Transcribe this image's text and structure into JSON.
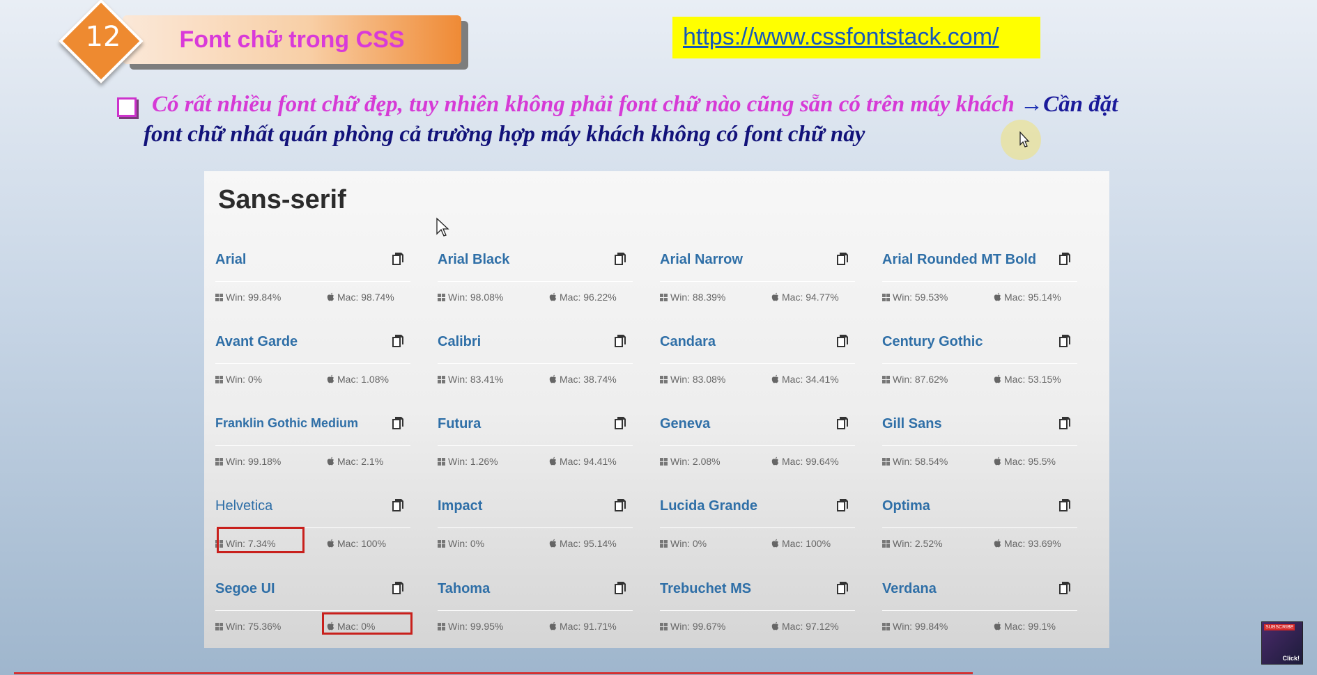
{
  "header": {
    "badge_number": "12",
    "title": "Font chữ trong CSS",
    "url": "https://www.cssfontstack.com/"
  },
  "bullet": {
    "line1_text": "Có rất nhiều font chữ đẹp, tuy nhiên không phải font chữ nào cũng sẵn có trên máy khách",
    "line1_arrow": "→",
    "line1_tail": "Cần đặt",
    "line2_text": "font chữ nhất quán phòng cả trường hợp máy khách không có font chữ này"
  },
  "panel": {
    "title": "Sans-serif",
    "fonts": [
      {
        "name": "Arial",
        "win": "Win: 99.84%",
        "mac": "Mac: 98.74%"
      },
      {
        "name": "Arial Black",
        "win": "Win: 98.08%",
        "mac": "Mac: 96.22%"
      },
      {
        "name": "Arial Narrow",
        "win": "Win: 88.39%",
        "mac": "Mac: 94.77%"
      },
      {
        "name": "Arial Rounded MT Bold",
        "win": "Win: 59.53%",
        "mac": "Mac: 95.14%"
      },
      {
        "name": "Avant Garde",
        "win": "Win: 0%",
        "mac": "Mac: 1.08%"
      },
      {
        "name": "Calibri",
        "win": "Win: 83.41%",
        "mac": "Mac: 38.74%"
      },
      {
        "name": "Candara",
        "win": "Win: 83.08%",
        "mac": "Mac: 34.41%"
      },
      {
        "name": "Century Gothic",
        "win": "Win: 87.62%",
        "mac": "Mac: 53.15%"
      },
      {
        "name": "Franklin Gothic Medium",
        "win": "Win: 99.18%",
        "mac": "Mac: 2.1%"
      },
      {
        "name": "Futura",
        "win": "Win: 1.26%",
        "mac": "Mac: 94.41%"
      },
      {
        "name": "Geneva",
        "win": "Win: 2.08%",
        "mac": "Mac: 99.64%"
      },
      {
        "name": "Gill Sans",
        "win": "Win: 58.54%",
        "mac": "Mac: 95.5%"
      },
      {
        "name": "Helvetica",
        "win": "Win: 7.34%",
        "mac": "Mac: 100%"
      },
      {
        "name": "Impact",
        "win": "Win: 0%",
        "mac": "Mac: 95.14%"
      },
      {
        "name": "Lucida Grande",
        "win": "Win: 0%",
        "mac": "Mac: 100%"
      },
      {
        "name": "Optima",
        "win": "Win: 2.52%",
        "mac": "Mac: 93.69%"
      },
      {
        "name": "Segoe UI",
        "win": "Win: 75.36%",
        "mac": "Mac: 0%"
      },
      {
        "name": "Tahoma",
        "win": "Win: 99.95%",
        "mac": "Mac: 91.71%"
      },
      {
        "name": "Trebuchet MS",
        "win": "Win: 99.67%",
        "mac": "Mac: 97.12%"
      },
      {
        "name": "Verdana",
        "win": "Win: 99.84%",
        "mac": "Mac: 99.1%"
      }
    ]
  },
  "thumbnail": {
    "subscribe_label": "SUBSCRIBE",
    "click_label": "Click!"
  },
  "colors": {
    "title_text": "#d93ad9",
    "url_bg": "#ffff00",
    "font_name": "#2f6fa7",
    "highlight_box": "#c8201c"
  },
  "icons": {
    "copy": "copy-icon",
    "windows": "windows-icon",
    "apple": "apple-icon"
  }
}
